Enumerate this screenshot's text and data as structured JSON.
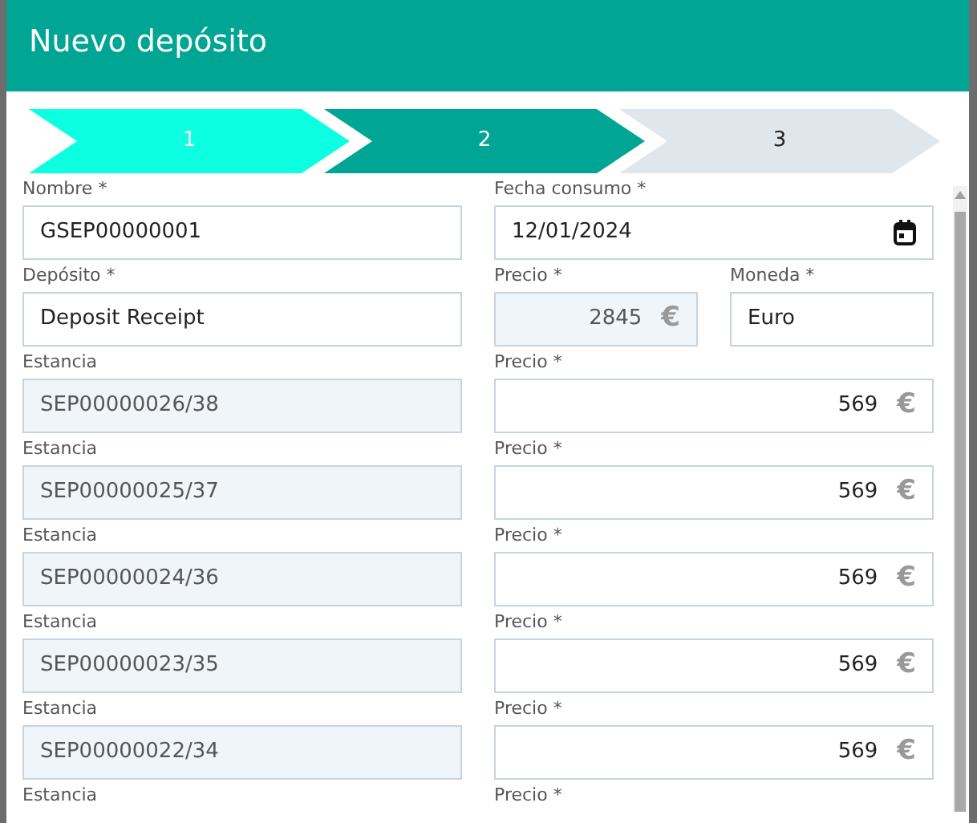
{
  "modal": {
    "title": "Nuevo depósito"
  },
  "steps": [
    {
      "label": "1",
      "completed": true,
      "selected": false
    },
    {
      "label": "2",
      "completed": false,
      "selected": true
    },
    {
      "label": "3",
      "completed": false,
      "selected": false
    }
  ],
  "rows": [
    {
      "cells": [
        {
          "label": "Nombre *",
          "value": "GSEP00000001",
          "kind": "text",
          "disabled": false
        },
        {
          "label": "Fecha consumo *",
          "value": "12/01/2024",
          "kind": "date",
          "disabled": false
        }
      ]
    },
    {
      "cells": [
        {
          "label": "Depósito *",
          "value": "Deposit Receipt",
          "kind": "text",
          "disabled": false
        },
        {
          "label": "Precio *",
          "value": "2845",
          "kind": "currency",
          "suffix": "€",
          "disabled": true
        },
        {
          "label": "Moneda *",
          "value": "Euro",
          "kind": "text",
          "disabled": false
        }
      ]
    },
    {
      "cells": [
        {
          "label": "Estancia",
          "value": "SEP00000026/38",
          "kind": "text",
          "disabled": true
        },
        {
          "label": "Precio *",
          "value": "569",
          "kind": "currency",
          "suffix": "€",
          "disabled": false
        }
      ]
    },
    {
      "cells": [
        {
          "label": "Estancia",
          "value": "SEP00000025/37",
          "kind": "text",
          "disabled": true
        },
        {
          "label": "Precio *",
          "value": "569",
          "kind": "currency",
          "suffix": "€",
          "disabled": false
        }
      ]
    },
    {
      "cells": [
        {
          "label": "Estancia",
          "value": "SEP00000024/36",
          "kind": "text",
          "disabled": true
        },
        {
          "label": "Precio *",
          "value": "569",
          "kind": "currency",
          "suffix": "€",
          "disabled": false
        }
      ]
    },
    {
      "cells": [
        {
          "label": "Estancia",
          "value": "SEP00000023/35",
          "kind": "text",
          "disabled": true
        },
        {
          "label": "Precio *",
          "value": "569",
          "kind": "currency",
          "suffix": "€",
          "disabled": false
        }
      ]
    },
    {
      "cells": [
        {
          "label": "Estancia",
          "value": "SEP00000022/34",
          "kind": "text",
          "disabled": true
        },
        {
          "label": "Precio *",
          "value": "569",
          "kind": "currency",
          "suffix": "€",
          "disabled": false
        }
      ]
    },
    {
      "cells": [
        {
          "label": "Estancia"
        },
        {
          "label": "Precio *"
        }
      ]
    }
  ]
}
